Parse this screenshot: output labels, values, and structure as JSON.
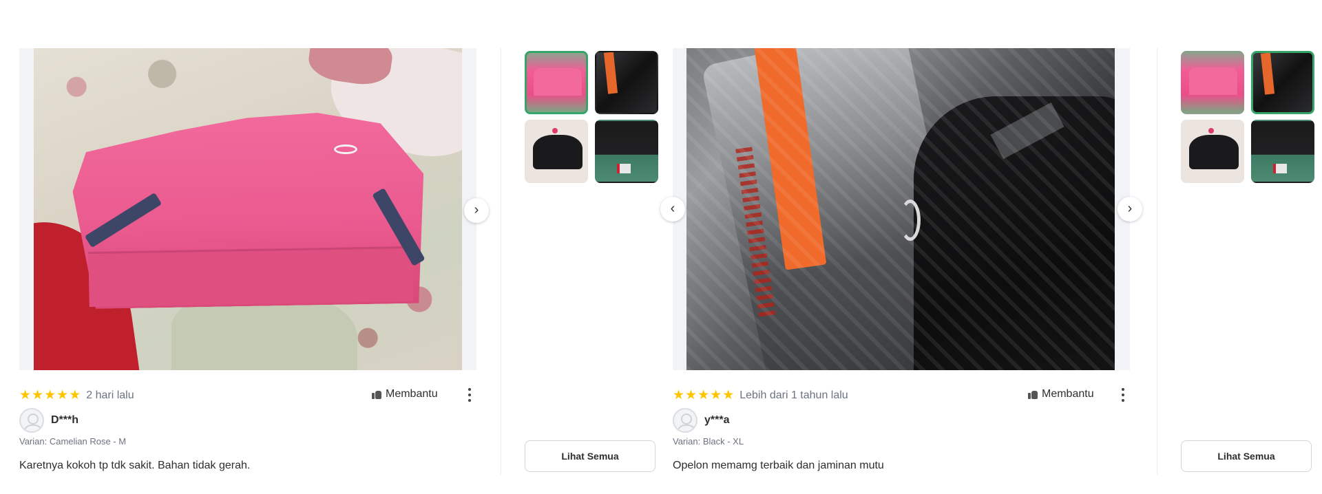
{
  "reviews": [
    {
      "rating": 5,
      "date": "2 hari lalu",
      "helpful_label": "Membantu",
      "username": "D***h",
      "variant": "Varian: Camelian Rose - M",
      "text": "Karetnya kokoh tp tdk sakit. Bahan tidak gerah."
    },
    {
      "rating": 5,
      "date": "Lebih dari 1 tahun lalu",
      "helpful_label": "Membantu",
      "username": "y***a",
      "variant": "Varian: Black - XL",
      "text": "Opelon memamg terbaik dan jaminan mutu"
    }
  ],
  "gallery": {
    "see_all_label": "Lihat Semua",
    "panel_1_active_thumb": 1,
    "panel_2_active_thumb": 2
  },
  "icons": {
    "star": "★",
    "next": "›",
    "prev": "‹"
  },
  "colors": {
    "star": "#ffc400",
    "active_thumb_border": "#35a56a"
  }
}
